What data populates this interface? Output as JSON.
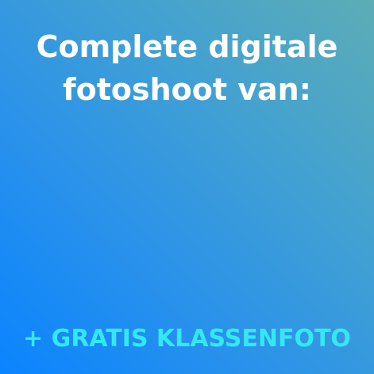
{
  "headline": {
    "line1": "Complete digitale",
    "line2": "fotoshoot van:"
  },
  "bonus": {
    "text": "+ GRATIS KLASSENFOTO"
  },
  "colors": {
    "gradient_start": "#0a84ff",
    "gradient_end": "#5cadb5",
    "headline_text": "#ffffff",
    "bonus_text": "#33e8f2"
  }
}
